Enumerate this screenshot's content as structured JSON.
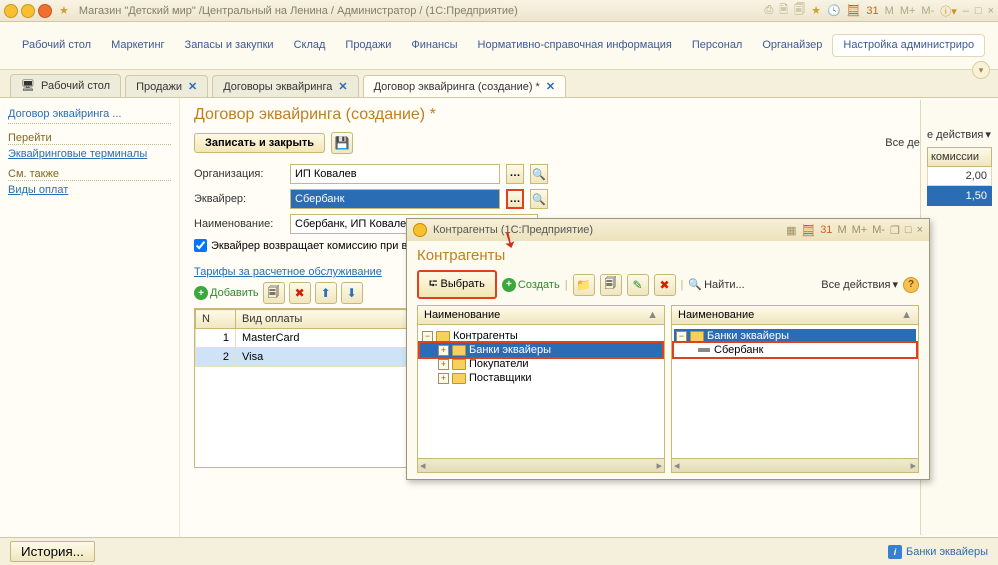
{
  "titlebar": {
    "title": "Магазин \"Детский мир\" /Центральный на Ленина / Администратор /  (1С:Предприятие)"
  },
  "sections": [
    "Рабочий стол",
    "Маркетинг",
    "Запасы и закупки",
    "Склад",
    "Продажи",
    "Финансы",
    "Нормативно-справочная информация",
    "Персонал",
    "Органайзер",
    "Настройка администриро"
  ],
  "tabs": [
    {
      "label": "Рабочий стол",
      "closable": false
    },
    {
      "label": "Продажи",
      "closable": true
    },
    {
      "label": "Договоры эквайринга",
      "closable": true
    },
    {
      "label": "Договор эквайринга (создание) *",
      "closable": true,
      "active": true
    }
  ],
  "leftnav": {
    "header": "Договор эквайринга ...",
    "group1": "Перейти",
    "link1": "Эквайринговые терминалы",
    "group2": "См. также",
    "link2": "Виды оплат"
  },
  "form": {
    "title": "Договор эквайринга (создание) *",
    "save_close": "Записать и закрыть",
    "all_actions": "Все действия",
    "org_label": "Организация:",
    "org_value": "ИП Ковалев",
    "acq_label": "Эквайрер:",
    "acq_value": "Сбербанк",
    "name_label": "Наименование:",
    "name_value": "Сбербанк, ИП Ковалев",
    "checkbox": "Эквайрер возвращает комиссию при в",
    "tariffs": "Тарифы за расчетное обслуживание",
    "add": "Добавить"
  },
  "grid": {
    "col_n": "N",
    "col_type": "Вид оплаты",
    "col_comm": "комиссии",
    "rows": [
      {
        "n": "1",
        "type": "MasterCard",
        "comm": "2,00"
      },
      {
        "n": "2",
        "type": "Visa",
        "comm": "1,50"
      }
    ]
  },
  "side": {
    "actions": "е действия"
  },
  "dialog": {
    "wintitle": "Контрагенты  (1С:Предприятие)",
    "title": "Контрагенты",
    "select": "Выбрать",
    "create": "Создать",
    "find": "Найти...",
    "all_actions": "Все действия",
    "col": "Наименование",
    "left_tree": [
      {
        "label": "Контрагенты",
        "level": 0,
        "exp": "-"
      },
      {
        "label": "Банки эквайеры",
        "level": 1,
        "exp": "+",
        "hl": true,
        "sel": true
      },
      {
        "label": "Покупатели",
        "level": 1,
        "exp": "+"
      },
      {
        "label": "Поставщики",
        "level": 1,
        "exp": "+"
      }
    ],
    "right_tree": [
      {
        "label": "Банки эквайеры",
        "level": 0,
        "exp": "-",
        "sel": true,
        "folder": true
      },
      {
        "label": "Сбербанк",
        "level": 1,
        "hl": true,
        "folder": false
      }
    ]
  },
  "statusbar": {
    "history": "История...",
    "hint": "Банки эквайеры"
  }
}
